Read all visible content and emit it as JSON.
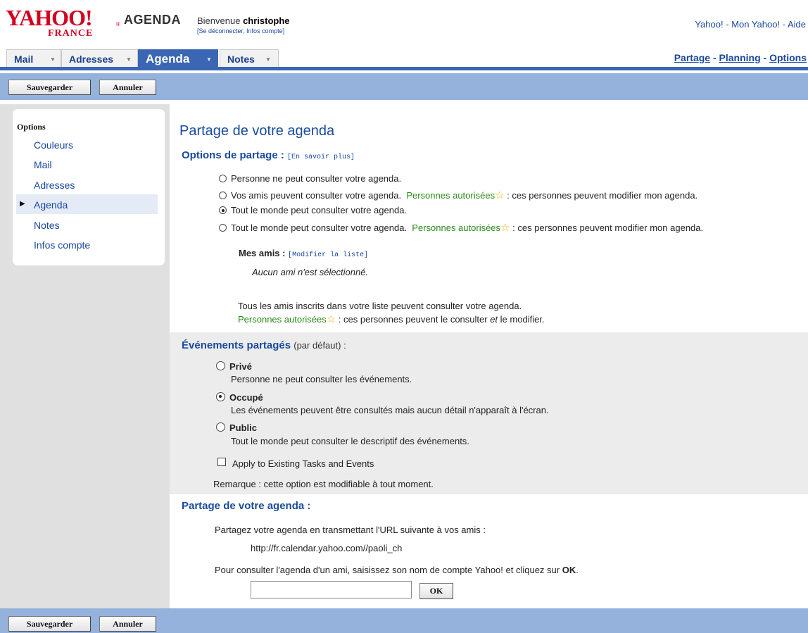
{
  "header": {
    "logo_text": "YAHOO!",
    "logo_sub": "FRANCE",
    "logo_reg": "®",
    "app_name": "AGENDA",
    "welcome_prefix": "Bienvenue",
    "user_name": "christophe",
    "account_links": "[Se déconnecter, Infos compte]",
    "top_links": [
      "Yahoo!",
      "Mon Yahoo!",
      "Aide"
    ],
    "separator": "-"
  },
  "tabs": [
    {
      "label": "Mail",
      "active": false
    },
    {
      "label": "Adresses",
      "active": false
    },
    {
      "label": "Agenda",
      "active": true
    },
    {
      "label": "Notes",
      "active": false
    }
  ],
  "tab_arrow": "▼",
  "right_links": [
    "Partage",
    "Planning",
    "Options"
  ],
  "toolbar": {
    "save_label": "Sauvegarder",
    "cancel_label": "Annuler"
  },
  "sidebar": {
    "heading": "Options",
    "items": [
      {
        "label": "Couleurs",
        "selected": false
      },
      {
        "label": "Mail",
        "selected": false
      },
      {
        "label": "Adresses",
        "selected": false
      },
      {
        "label": "Agenda",
        "selected": true
      },
      {
        "label": "Notes",
        "selected": false
      },
      {
        "label": "Infos compte",
        "selected": false
      }
    ],
    "bullet": "▶"
  },
  "main": {
    "title": "Partage de votre agenda",
    "share_options": {
      "heading": "Options de partage :",
      "learn_more": "[En savoir plus]",
      "options": [
        {
          "text": "Personne ne peut consulter votre agenda.",
          "selected": false
        },
        {
          "text": "Vos amis peuvent consulter votre agenda.",
          "authorized": "Personnes autorisées",
          "suffix": ": ces personnes peuvent modifier mon agenda.",
          "selected": false
        },
        {
          "text": "Tout le monde peut consulter votre agenda.",
          "selected": true
        },
        {
          "text": "Tout le monde peut consulter votre agenda.",
          "authorized": "Personnes autorisées",
          "suffix": ": ces personnes peuvent modifier mon agenda.",
          "selected": false
        }
      ],
      "star": "☆",
      "friends_label": "Mes amis :",
      "modify_list": "[Modifier la liste]",
      "no_friends": "Aucun ami n'est sélectionné.",
      "all_friends_note": "Tous les amis inscrits dans votre liste peuvent consulter votre agenda.",
      "authorized_note_label": "Personnes autorisées",
      "authorized_note_a": ": ces personnes peuvent le consulter",
      "authorized_note_et": "et",
      "authorized_note_b": "le modifier."
    },
    "shared_events": {
      "heading": "Événements partagés",
      "heading_note": "(par défaut) :",
      "options": [
        {
          "title": "Privé",
          "desc": "Personne ne peut consulter les événements.",
          "selected": false
        },
        {
          "title": "Occupé",
          "desc": "Les événements peuvent être consultés mais aucun détail n'apparaît à l'écran.",
          "selected": true
        },
        {
          "title": "Public",
          "desc": "Tout le monde peut consulter le descriptif des événements.",
          "selected": false
        }
      ],
      "apply_label": "Apply to Existing Tasks and Events",
      "apply_checked": false,
      "remark": "Remarque : cette option est modifiable à tout moment."
    },
    "share_agenda": {
      "heading": "Partage de votre agenda :",
      "url_intro": "Partagez votre agenda en transmettant l'URL suivante à vos amis :",
      "url": "http://fr.calendar.yahoo.com//paoli_ch",
      "lookup_text": "Pour consulter l'agenda d'un ami, saisissez son nom de compte Yahoo! et cliquez sur",
      "lookup_ok_word": "OK",
      "lookup_end": ".",
      "input_value": "",
      "ok_label": "OK"
    }
  },
  "colors": {
    "brand": "#d2001e",
    "nav_blue": "#3b66b3",
    "bar_blue": "#94b2dc",
    "link": "#1a47a0",
    "green": "#2a8a1a"
  }
}
